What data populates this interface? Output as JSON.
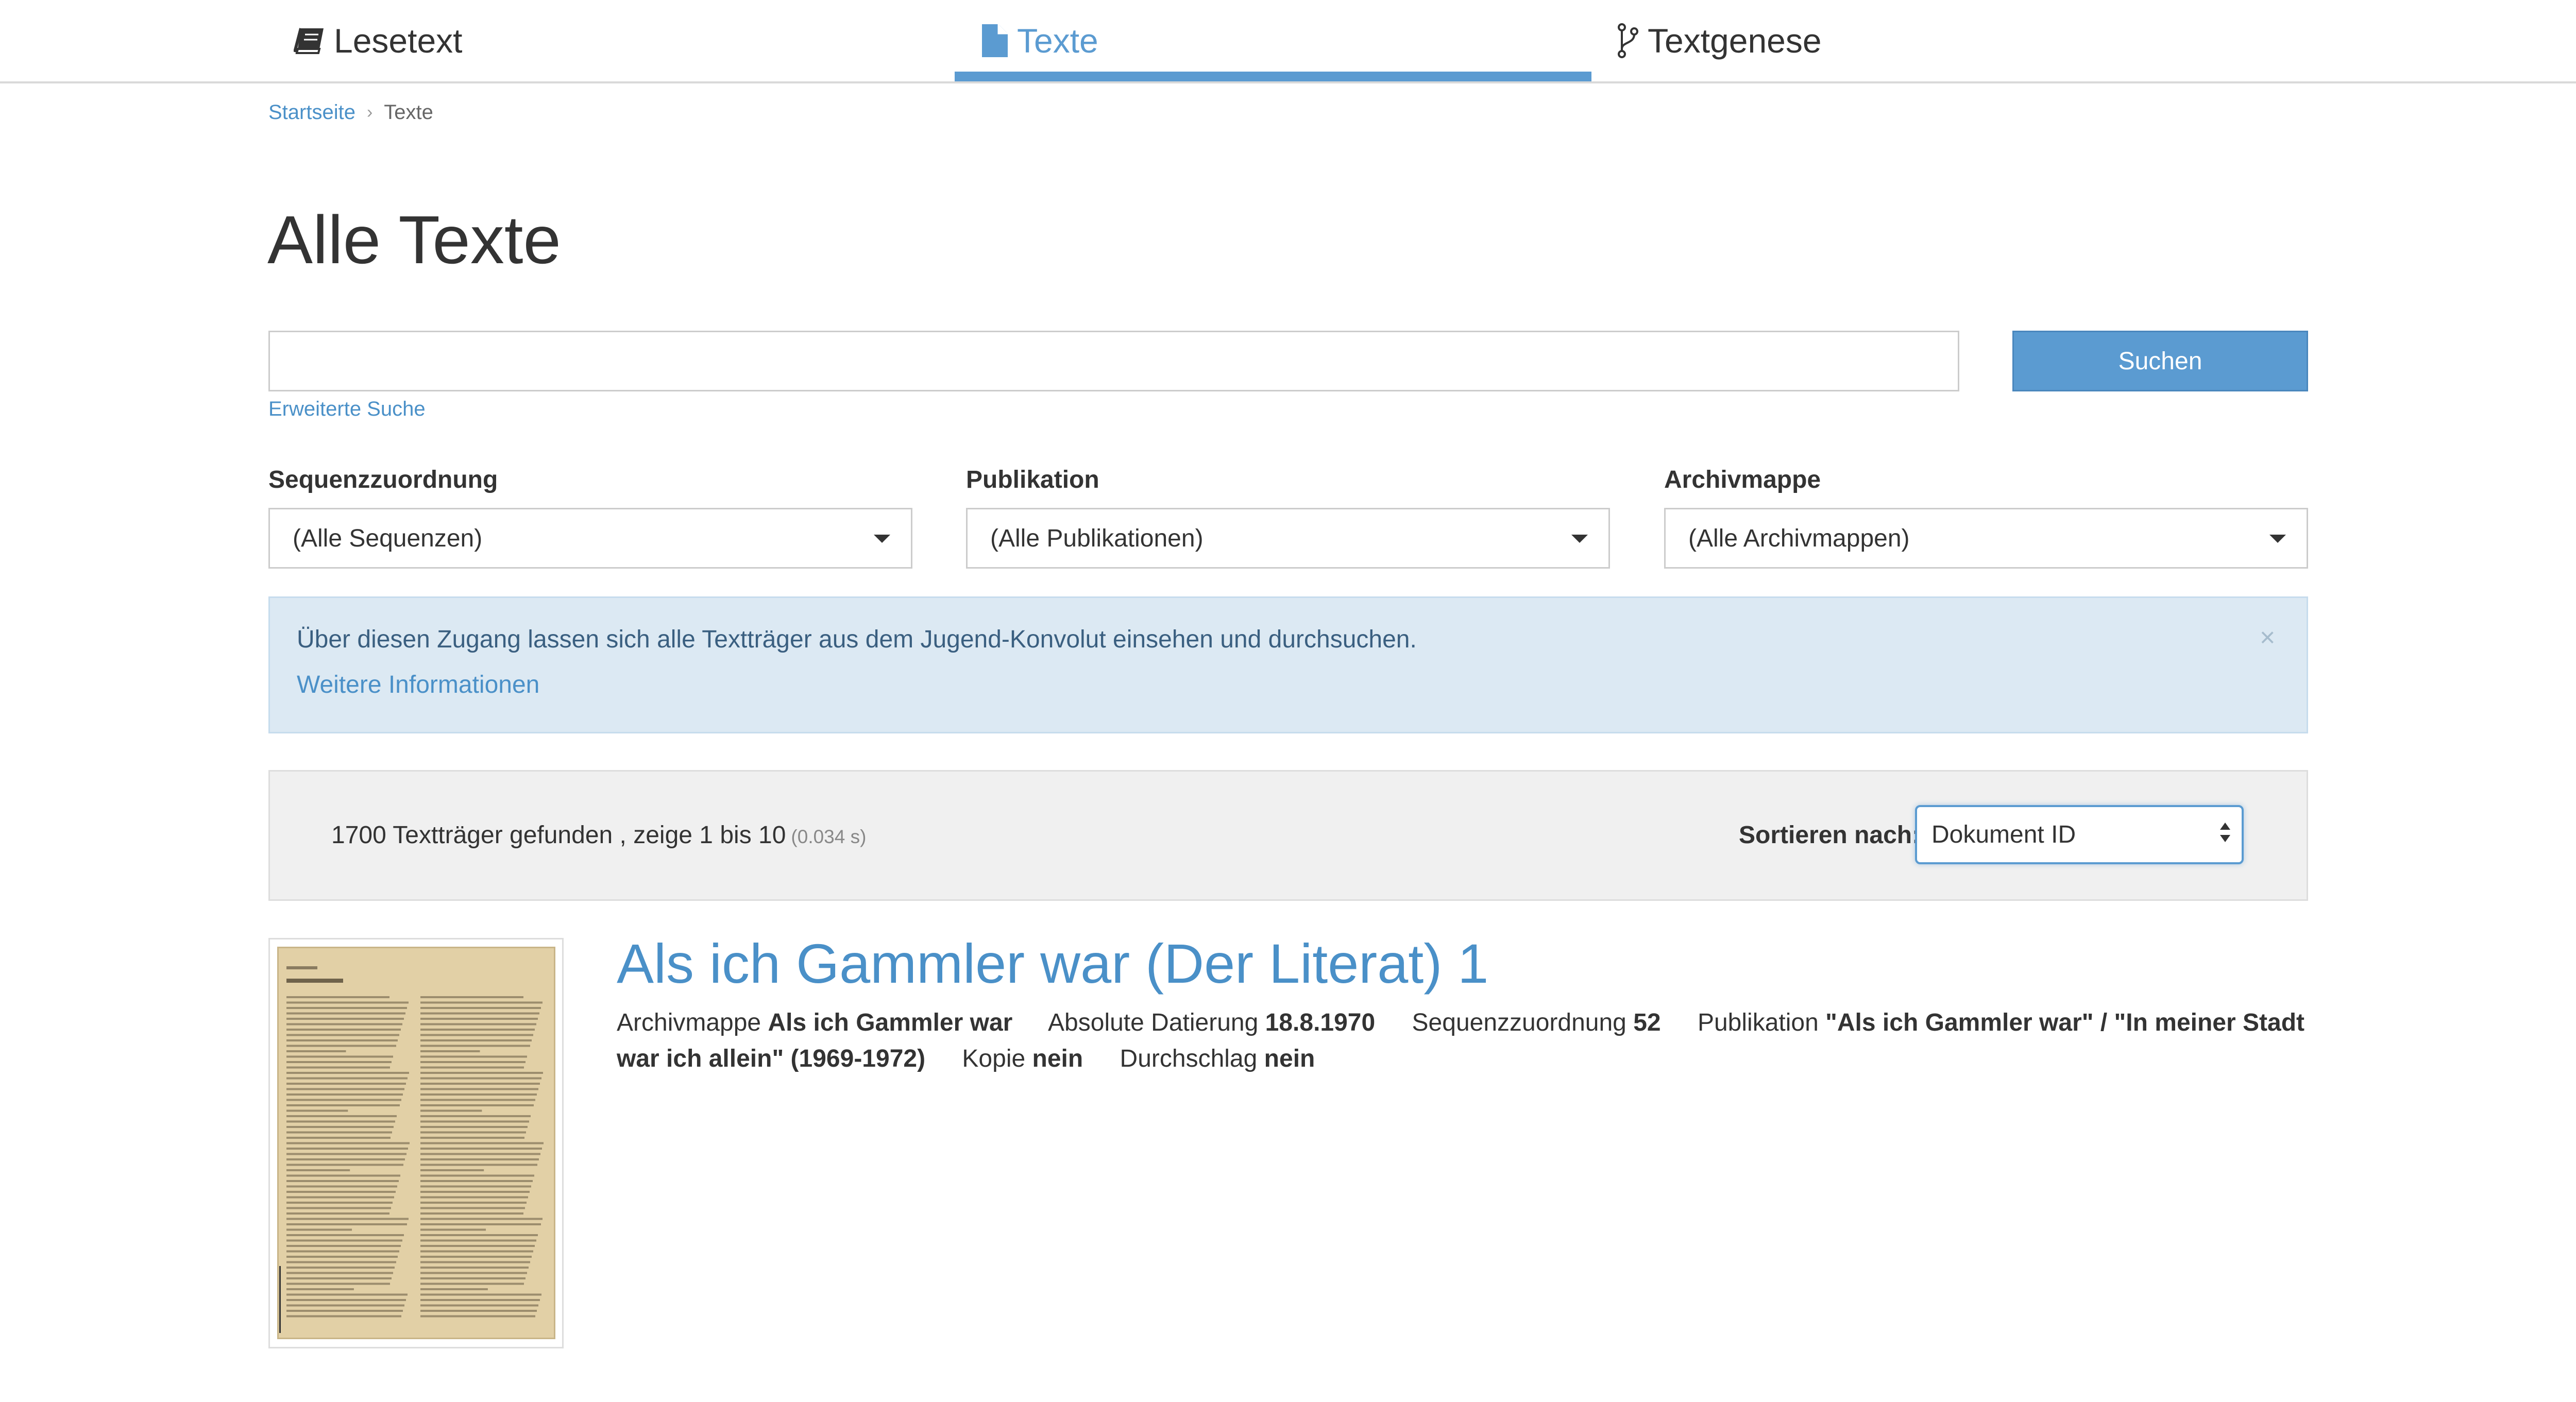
{
  "nav": {
    "tabs": [
      {
        "label": "Lesetext",
        "icon": "book-icon"
      },
      {
        "label": "Texte",
        "icon": "document-icon",
        "active": true
      },
      {
        "label": "Textgenese",
        "icon": "code-branch-icon"
      }
    ]
  },
  "breadcrumb": {
    "home": "Startseite",
    "separator": "›",
    "current": "Texte"
  },
  "page": {
    "title": "Alle Texte"
  },
  "search": {
    "value": "",
    "button_label": "Suchen",
    "advanced_link": "Erweiterte Suche"
  },
  "filters": {
    "sequence": {
      "label": "Sequenzzuordnung",
      "selected": "(Alle Sequenzen)"
    },
    "publication": {
      "label": "Publikation",
      "selected": "(Alle Publikationen)"
    },
    "archive": {
      "label": "Archivmappe",
      "selected": "(Alle Archivmappen)"
    }
  },
  "alert": {
    "text": "Über diesen Zugang lassen sich alle Textträger aus dem Jugend-Konvolut einsehen und durchsuchen.",
    "link": "Weitere Informationen",
    "close": "×"
  },
  "results": {
    "summary": "1700 Textträger gefunden , zeige 1 bis 10",
    "time": "(0.034 s)",
    "sort_label": "Sortieren nach:",
    "sort_selected": "Dokument ID"
  },
  "result_items": [
    {
      "title": "Als ich Gammler war (Der Literat) 1",
      "meta": [
        {
          "label": "Archivmappe",
          "value": "Als ich Gammler war"
        },
        {
          "label": "Absolute Datierung",
          "value": "18.8.1970"
        },
        {
          "label": "Sequenzzuordnung",
          "value": "52"
        },
        {
          "label": "Publikation",
          "value": "\"Als ich Gammler war\" / \"In meiner Stadt war ich allein\" (1969-1972)"
        },
        {
          "label": "Kopie",
          "value": "nein"
        },
        {
          "label": "Durchschlag",
          "value": "nein"
        }
      ]
    }
  ],
  "colors": {
    "accent": "#5b9bd1",
    "link": "#4a90c8",
    "alert_bg": "#dce9f3",
    "results_bar_bg": "#f0f0f0",
    "thumbnail_paper": "#e2d0a6"
  }
}
